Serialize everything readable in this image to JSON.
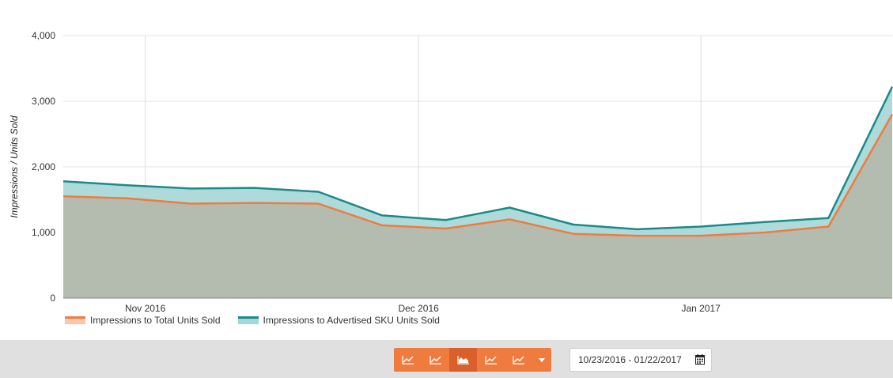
{
  "chart_data": {
    "type": "area",
    "x": [
      "2016-10-23",
      "2016-10-30",
      "2016-11-06",
      "2016-11-13",
      "2016-11-20",
      "2016-11-27",
      "2016-12-04",
      "2016-12-11",
      "2016-12-18",
      "2016-12-25",
      "2017-01-01",
      "2017-01-08",
      "2017-01-15",
      "2017-01-22"
    ],
    "x_tick_labels": [
      "Nov 2016",
      "Dec 2016",
      "Jan 2017"
    ],
    "x_tick_dates": [
      "2016-11-01",
      "2016-12-01",
      "2017-01-01"
    ],
    "ylabel": "Impressions / Units Sold",
    "ylim": [
      0,
      4000
    ],
    "y_ticks": [
      "0",
      "1,000",
      "2,000",
      "3,000",
      "4,000"
    ],
    "y_tick_values": [
      0,
      1000,
      2000,
      3000,
      4000
    ],
    "grid": true,
    "legend_position": "bottom-left",
    "series": [
      {
        "name": "Impressions to Advertised SKU Units Sold",
        "color": "#1a8a8a",
        "fill": "#a6d6d6",
        "values": [
          1780,
          1720,
          1670,
          1680,
          1620,
          1260,
          1190,
          1380,
          1120,
          1050,
          1090,
          1160,
          1220,
          3220
        ]
      },
      {
        "name": "Impressions to Total Units Sold",
        "color": "#f07b3f",
        "fill": "#b3bcae",
        "values": [
          1550,
          1520,
          1440,
          1450,
          1440,
          1110,
          1060,
          1200,
          980,
          950,
          950,
          1000,
          1090,
          2800
        ]
      }
    ]
  },
  "legend": [
    {
      "label": "Impressions to Total Units Sold",
      "color": "#f07b3f",
      "fill": "#f9c7ad"
    },
    {
      "label": "Impressions to Advertised SKU Units Sold",
      "color": "#1a8a8a",
      "fill": "#a6d6d6"
    }
  ],
  "toolbar": {
    "buttons": [
      "line-chart-icon",
      "line-chart-icon",
      "area-chart-icon",
      "line-chart-icon",
      "line-chart-icon",
      "caret-down-icon"
    ],
    "active_index": 2,
    "accent": "#f07b3f",
    "active_color": "#d9602a"
  },
  "date_range": {
    "value": "10/23/2016 - 01/22/2017",
    "icon": "calendar-icon"
  }
}
